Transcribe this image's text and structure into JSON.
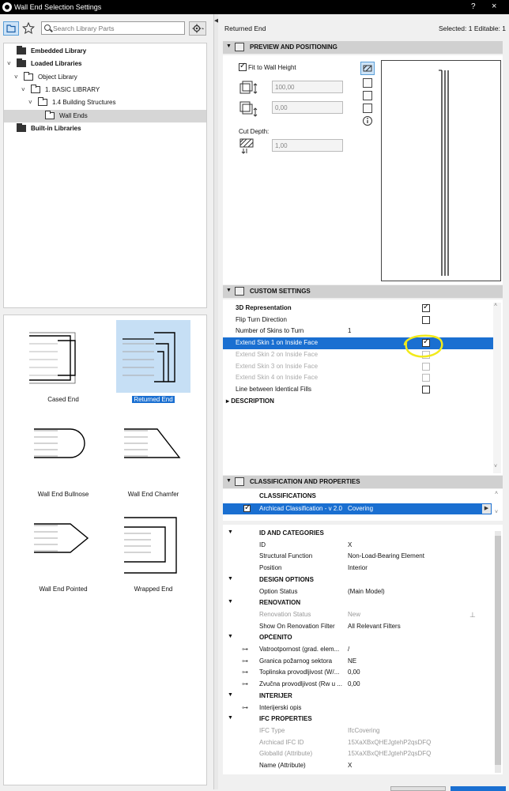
{
  "window": {
    "title": "Wall End Selection Settings",
    "help": "?",
    "close": "×"
  },
  "left": {
    "search_placeholder": "Search Library Parts",
    "tree": [
      {
        "label": "Embedded Library",
        "bold": true,
        "indent": 0,
        "chev": "",
        "dark": true
      },
      {
        "label": "Loaded Libraries",
        "bold": true,
        "indent": 0,
        "chev": "˅",
        "dark": true
      },
      {
        "label": "Object Library",
        "bold": false,
        "indent": 1,
        "chev": "˅",
        "dark": false
      },
      {
        "label": "1. BASIC LIBRARY",
        "bold": false,
        "indent": 2,
        "chev": "˅",
        "dark": false
      },
      {
        "label": "1.4 Building Structures",
        "bold": false,
        "indent": 3,
        "chev": "˅",
        "dark": false
      },
      {
        "label": "Wall Ends",
        "bold": false,
        "indent": 4,
        "chev": "",
        "dark": false,
        "selected": true
      },
      {
        "label": "Built-in Libraries",
        "bold": true,
        "indent": 0,
        "chev": "",
        "dark": true
      }
    ],
    "thumbs": [
      {
        "label": "Cased End",
        "shape": "cased"
      },
      {
        "label": "Returned End",
        "shape": "returned",
        "selected": true
      },
      {
        "label": "Wall End Bullnose",
        "shape": "bullnose"
      },
      {
        "label": "Wall End Chamfer",
        "shape": "chamfer"
      },
      {
        "label": "Wall End Pointed",
        "shape": "pointed"
      },
      {
        "label": "Wrapped End",
        "shape": "wrapped"
      }
    ]
  },
  "right": {
    "object_name": "Returned End",
    "selection_status": "Selected: 1 Editable: 1",
    "preview": {
      "header": "PREVIEW AND POSITIONING",
      "fit_label": "Fit to Wall Height",
      "fit_checked": true,
      "value1": "100,00",
      "value2": "0,00",
      "cut_depth_label": "Cut Depth:",
      "value3": "1,00"
    },
    "custom": {
      "header": "CUSTOM SETTINGS",
      "rows": [
        {
          "label": "3D Representation",
          "bold": true,
          "value": "",
          "check": "on"
        },
        {
          "label": "Flip Turn Direction",
          "value": "",
          "check": "off"
        },
        {
          "label": "Number of Skins to Turn",
          "value": "1",
          "check": ""
        },
        {
          "label": "Extend Skin 1 on Inside Face",
          "value": "",
          "check": "on",
          "selected": true
        },
        {
          "label": "Extend Skin 2 on Inside Face",
          "value": "",
          "check": "dis",
          "disabled": true
        },
        {
          "label": "Extend Skin 3 on Inside Face",
          "value": "",
          "check": "dis",
          "disabled": true
        },
        {
          "label": "Extend Skin 4 on Inside Face",
          "value": "",
          "check": "dis",
          "disabled": true
        },
        {
          "label": "Line between Identical Fills",
          "value": "",
          "check": "off"
        }
      ],
      "description_label": "DESCRIPTION"
    },
    "classification": {
      "header": "CLASSIFICATION AND PROPERTIES",
      "sub": "CLASSIFICATIONS",
      "item": "Archicad Classification - v 2.0",
      "item_value": "Covering"
    },
    "properties": [
      {
        "type": "group",
        "label": "ID AND CATEGORIES"
      },
      {
        "type": "row",
        "label": "ID",
        "value": "X"
      },
      {
        "type": "row",
        "label": "Structural Function",
        "value": "Non-Load-Bearing Element"
      },
      {
        "type": "row",
        "label": "Position",
        "value": "Interior"
      },
      {
        "type": "group",
        "label": "DESIGN OPTIONS"
      },
      {
        "type": "row",
        "label": "Option Status",
        "value": "(Main Model)"
      },
      {
        "type": "group",
        "label": "RENOVATION"
      },
      {
        "type": "row",
        "label": "Renovation Status",
        "value": "New",
        "grey": true,
        "ricon": true
      },
      {
        "type": "row",
        "label": "Show On Renovation Filter",
        "value": "All Relevant Filters"
      },
      {
        "type": "group",
        "label": "OPĆENITO"
      },
      {
        "type": "row",
        "label": "Vatrootpornost (grad. elem...",
        "value": "/",
        "link": true
      },
      {
        "type": "row",
        "label": "Granica požarnog sektora",
        "value": "NE",
        "link": true
      },
      {
        "type": "row",
        "label": "Toplinska provodljivost (W/...",
        "value": "0,00",
        "link": true
      },
      {
        "type": "row",
        "label": "Zvučna provodljivost (Rw u ...",
        "value": "0,00",
        "link": true
      },
      {
        "type": "group",
        "label": "INTERIJER"
      },
      {
        "type": "row",
        "label": "Interijerski opis",
        "value": "",
        "link": true
      },
      {
        "type": "group",
        "label": "IFC PROPERTIES"
      },
      {
        "type": "row",
        "label": "IFC Type",
        "value": "IfcCovering",
        "grey": true
      },
      {
        "type": "row",
        "label": "Archicad IFC ID",
        "value": "15XaXBxQHEJgtehP2qsDFQ",
        "grey": true
      },
      {
        "type": "row",
        "label": "GlobalId (Attribute)",
        "value": "15XaXBxQHEJgtehP2qsDFQ",
        "grey": true
      },
      {
        "type": "row",
        "label": "Name (Attribute)",
        "value": "X"
      }
    ]
  }
}
